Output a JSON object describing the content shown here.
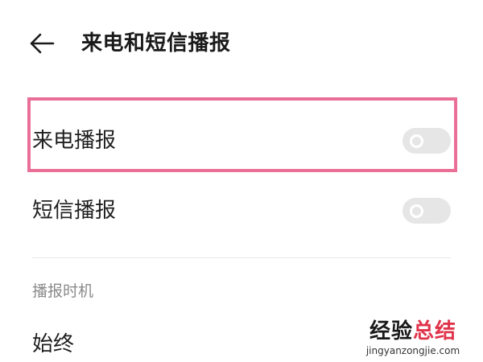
{
  "header": {
    "back_icon": "arrow-left-icon",
    "title": "来电和短信播报"
  },
  "settings": [
    {
      "label": "来电播报",
      "enabled": false
    },
    {
      "label": "短信播报",
      "enabled": false
    }
  ],
  "section": {
    "header": "播报时机"
  },
  "timing": {
    "value": "始终"
  },
  "watermark": {
    "text_part1": "经验",
    "text_part2": "总结",
    "url": "jingyanzongjie.com"
  },
  "colors": {
    "highlight": "#ea6f97",
    "toggle_off": "#e6e6e6",
    "watermark_accent": "#e0334a"
  }
}
